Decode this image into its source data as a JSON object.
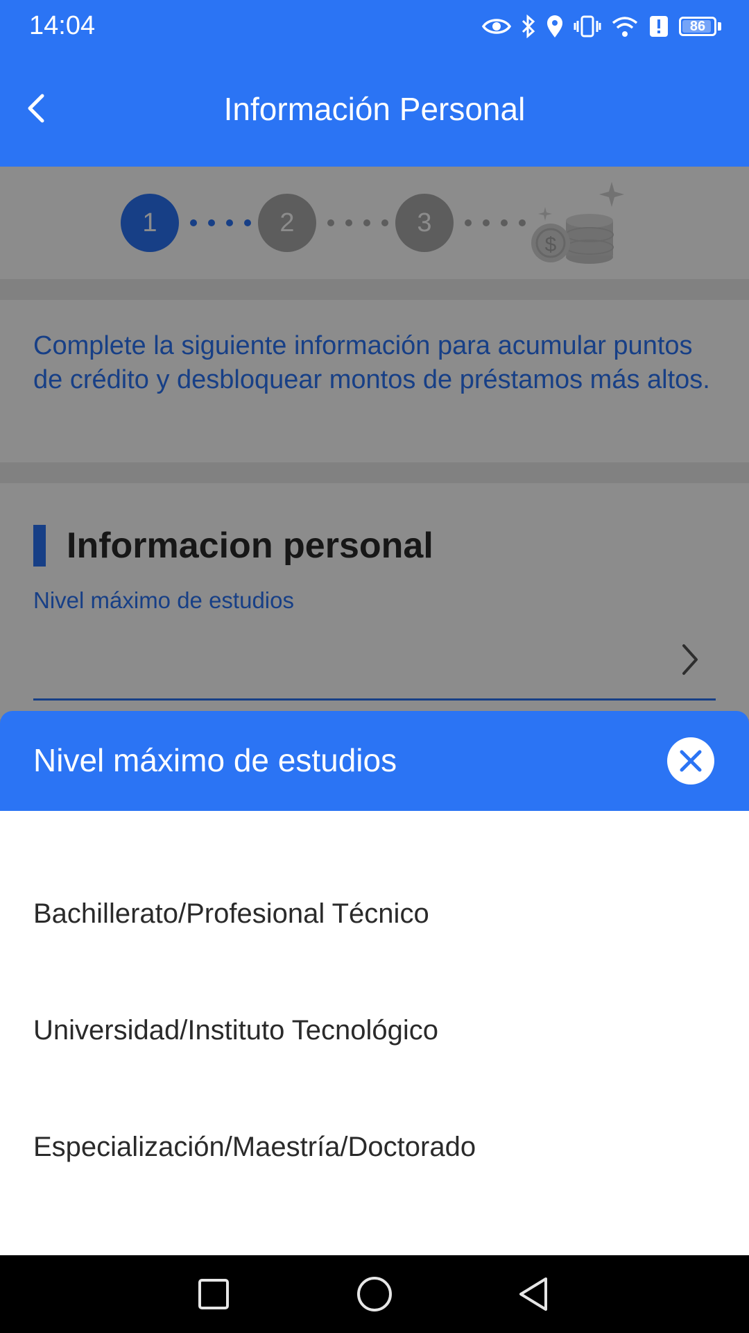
{
  "status_bar": {
    "time": "14:04",
    "battery_level": "86",
    "icons": [
      "eye-icon",
      "bluetooth-icon",
      "location-icon",
      "vibrate-icon",
      "wifi-icon",
      "alert-icon",
      "battery-icon"
    ]
  },
  "header": {
    "title": "Información Personal",
    "back_icon": "chevron-left-icon"
  },
  "stepper": {
    "steps": [
      "1",
      "2",
      "3"
    ],
    "active_step": 1,
    "active_color": "#2b74f4",
    "inactive_color": "#a9a9a9",
    "goal_icon": "coins-icon"
  },
  "notice": {
    "text": "Complete la siguiente información para acumular puntos de crédito y desbloquear montos de préstamos más altos."
  },
  "form": {
    "section_title": "Informacion personal",
    "field_label": "Nivel máximo de estudios",
    "field_value": ""
  },
  "sheet": {
    "title": "Nivel máximo de estudios",
    "close_icon": "close-icon",
    "options": [
      "Bachillerato/Profesional Técnico",
      "Universidad/Instituto Tecnológico",
      "Especialización/Maestría/Doctorado"
    ]
  },
  "nav_bar": {
    "icons": [
      "recent-apps-icon",
      "home-icon",
      "back-icon"
    ]
  },
  "colors": {
    "brand": "#2b74f4",
    "overlay": "rgba(0,0,0,0.45)"
  }
}
